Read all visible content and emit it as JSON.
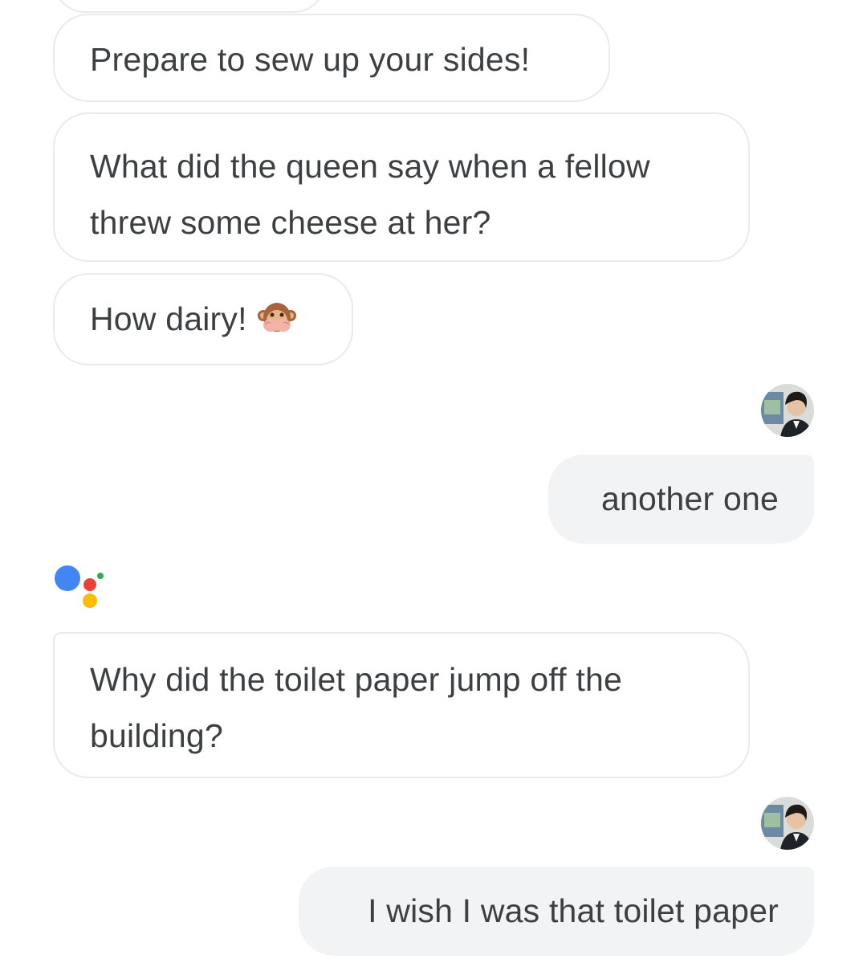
{
  "messages": [
    {
      "sender": "assistant",
      "text": "Prepare to sew up your sides!"
    },
    {
      "sender": "assistant",
      "text": "What did the queen say when a fellow threw some cheese at her?"
    },
    {
      "sender": "assistant",
      "text": "How dairy!",
      "emoji": "see-no-evil-monkey"
    },
    {
      "sender": "user",
      "text": "another one"
    },
    {
      "sender": "assistant",
      "text": "Why did the toilet paper jump off the building?"
    },
    {
      "sender": "user",
      "text": "I wish I was that toilet paper"
    }
  ],
  "colors": {
    "assistant_bubble_border": "#e8eaed",
    "user_bubble_bg": "#f1f3f4",
    "text": "#3c4043",
    "logo_blue": "#4285f4",
    "logo_red": "#ea4335",
    "logo_yellow": "#fbbc04",
    "logo_green": "#34a853"
  }
}
